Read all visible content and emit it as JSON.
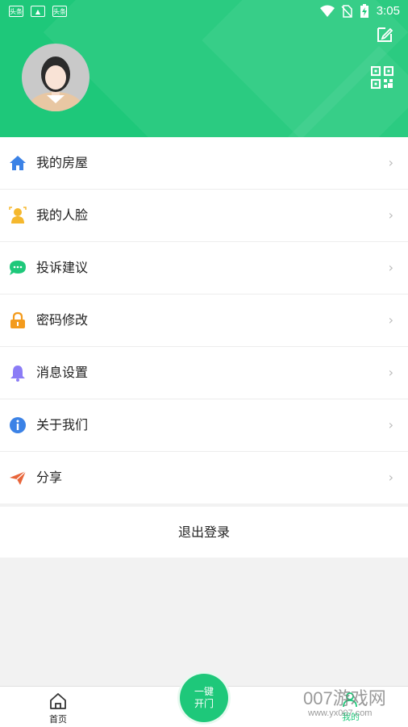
{
  "status_bar": {
    "time": "3:05",
    "notif1": "头条",
    "notif3": "头条"
  },
  "menu": {
    "items": [
      {
        "label": "我的房屋",
        "icon": "house-icon",
        "color": "#3b82e6"
      },
      {
        "label": "我的人脸",
        "icon": "face-icon",
        "color": "#f5b82e"
      },
      {
        "label": "投诉建议",
        "icon": "chat-icon",
        "color": "#1ec87a"
      },
      {
        "label": "密码修改",
        "icon": "lock-icon",
        "color": "#f39b1d"
      },
      {
        "label": "消息设置",
        "icon": "bell-icon",
        "color": "#8b7cf6"
      },
      {
        "label": "关于我们",
        "icon": "info-icon",
        "color": "#3b82e6"
      },
      {
        "label": "分享",
        "icon": "paper-plane-icon",
        "color": "#e8653a"
      }
    ],
    "arrow": "›"
  },
  "logout_label": "退出登录",
  "bottom_nav": {
    "home_label": "首页",
    "door_line1": "一键",
    "door_line2": "开门",
    "mine_label": "我的"
  },
  "watermark": {
    "line1": "007游戏网",
    "line2": "www.yx007.com"
  },
  "colors": {
    "brand": "#1ec87a",
    "background": "#f2f2f2"
  }
}
